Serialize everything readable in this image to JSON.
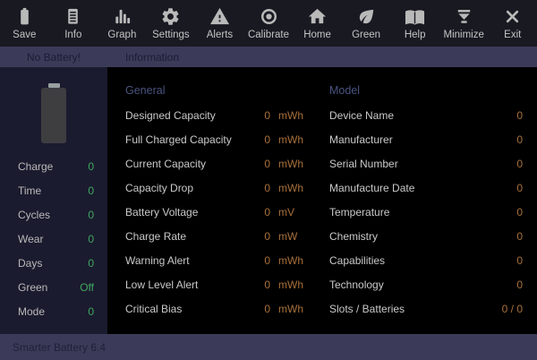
{
  "app": {
    "name": "Smarter Battery",
    "version": "6.4"
  },
  "toolbar": {
    "items": [
      {
        "label": "Save",
        "icon": "battery-save-icon"
      },
      {
        "label": "Info",
        "icon": "info-document-icon"
      },
      {
        "label": "Graph",
        "icon": "graph-bars-icon"
      },
      {
        "label": "Settings",
        "icon": "settings-gear-icon"
      },
      {
        "label": "Alerts",
        "icon": "alerts-warning-icon"
      },
      {
        "label": "Calibrate",
        "icon": "calibrate-target-icon"
      },
      {
        "label": "Home",
        "icon": "home-icon"
      },
      {
        "label": "Green",
        "icon": "green-leaf-icon"
      },
      {
        "label": "Help",
        "icon": "help-book-icon"
      },
      {
        "label": "Minimize",
        "icon": "minimize-icon"
      },
      {
        "label": "Exit",
        "icon": "exit-icon"
      }
    ]
  },
  "subheader": {
    "battery_status": "No Battery!",
    "tab": "Information"
  },
  "sidebar": {
    "rows": [
      {
        "label": "Charge",
        "value": "0"
      },
      {
        "label": "Time",
        "value": "0"
      },
      {
        "label": "Cycles",
        "value": "0"
      },
      {
        "label": "Wear",
        "value": "0"
      },
      {
        "label": "Days",
        "value": "0"
      },
      {
        "label": "Green",
        "value": "Off"
      },
      {
        "label": "Mode",
        "value": "0"
      }
    ]
  },
  "general": {
    "title": "General",
    "rows": [
      {
        "label": "Designed Capacity",
        "value": "0",
        "unit": "mWh"
      },
      {
        "label": "Full Charged Capacity",
        "value": "0",
        "unit": "mWh"
      },
      {
        "label": "Current Capacity",
        "value": "0",
        "unit": "mWh"
      },
      {
        "label": "Capacity Drop",
        "value": "0",
        "unit": "mWh"
      },
      {
        "label": "Battery Voltage",
        "value": "0",
        "unit": "mV"
      },
      {
        "label": "Charge Rate",
        "value": "0",
        "unit": "mW"
      },
      {
        "label": "Warning Alert",
        "value": "0",
        "unit": "mWh"
      },
      {
        "label": "Low Level Alert",
        "value": "0",
        "unit": "mWh"
      },
      {
        "label": "Critical Bias",
        "value": "0",
        "unit": "mWh"
      }
    ]
  },
  "model": {
    "title": "Model",
    "rows": [
      {
        "label": "Device Name",
        "value": "0"
      },
      {
        "label": "Manufacturer",
        "value": "0"
      },
      {
        "label": "Serial Number",
        "value": "0"
      },
      {
        "label": "Manufacture Date",
        "value": "0"
      },
      {
        "label": "Temperature",
        "value": "0"
      },
      {
        "label": "Chemistry",
        "value": "0"
      },
      {
        "label": "Capabilities",
        "value": "0"
      },
      {
        "label": "Technology",
        "value": "0"
      },
      {
        "label": "Slots / Batteries",
        "value": "0 / 0"
      }
    ]
  },
  "statusbar": {
    "text": "Smarter Battery 6.4"
  },
  "colors": {
    "toolbar_bg": "#191922",
    "bar_bg": "#3b3b59",
    "sidebar_bg": "#1b1b2f",
    "main_bg": "#000000",
    "icon_gray": "#b9b9b9",
    "value_green": "#3fa75f",
    "value_orange": "#a8703a",
    "section_title_blue": "#4a5480",
    "bar_text": "#1c1c36"
  }
}
